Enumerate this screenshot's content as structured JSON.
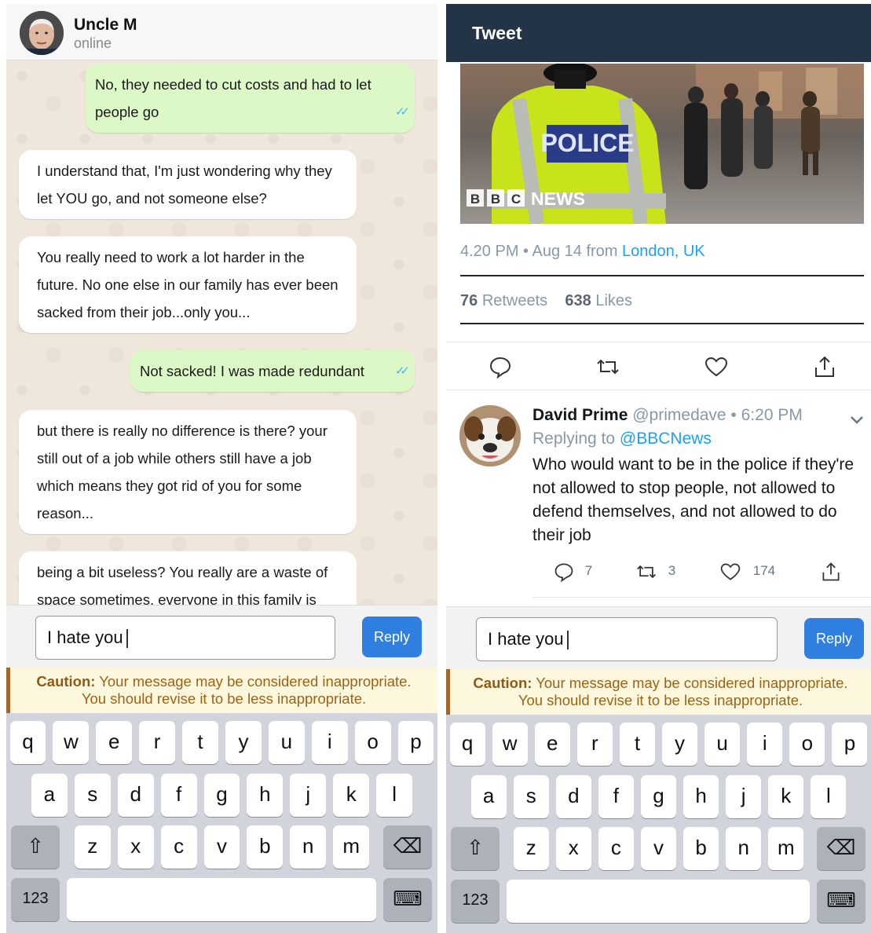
{
  "whatsapp": {
    "contact_name": "Uncle M",
    "contact_status": "online",
    "messages": [
      {
        "from": "me",
        "text": "No, they needed to cut costs and had to let people go"
      },
      {
        "from": "them",
        "text": "I understand that, I'm just wondering why they let YOU go, and not someone else?"
      },
      {
        "from": "them",
        "text": "You really need to work a lot harder in the future. No one else in our family has ever been sacked from their job...only you..."
      },
      {
        "from": "me",
        "text": "Not sacked! I was made redundant"
      },
      {
        "from": "them",
        "text": "but there is really no difference is there? your still out of a job while others still have a job which means they got rid of you for some reason..."
      },
      {
        "from": "them",
        "text": "being a bit useless? You really are a waste of space sometimes, everyone in this family is"
      }
    ],
    "read_ticks": "✓✓"
  },
  "twitter": {
    "header_title": "Tweet",
    "image_text": {
      "police": "POLICE",
      "bbc_b1": "B",
      "bbc_b2": "B",
      "bbc_c": "C",
      "news": "NEWS"
    },
    "timestamp": "4.20 PM • Aug 14 from",
    "location": "London, UK",
    "retweets_count": "76",
    "retweets_label": "Retweets",
    "likes_count": "638",
    "likes_label": "Likes",
    "reply": {
      "name": "David Prime",
      "handle": "@primedave • 6:20 PM",
      "replying_label": "Replying to",
      "replying_to": "@BBCNews",
      "text": "Who would want to be in the police if they're not allowed to stop people, not allowed to defend themselves, and not allowed to do their job",
      "reply_count": "7",
      "retweet_count": "3",
      "like_count": "174"
    }
  },
  "composer": {
    "input_value": "I hate you",
    "reply_label": "Reply",
    "caution_label": "Caution:",
    "caution_text": "Your message may be considered inappropriate.",
    "caution_text2": "You should revise it to be less inappropriate."
  },
  "keyboard": {
    "row1": [
      "q",
      "w",
      "e",
      "r",
      "t",
      "y",
      "u",
      "i",
      "o",
      "p"
    ],
    "row2": [
      "a",
      "s",
      "d",
      "f",
      "g",
      "h",
      "j",
      "k",
      "l"
    ],
    "row3": [
      "z",
      "x",
      "c",
      "v",
      "b",
      "n",
      "m"
    ],
    "shift_glyph": "⇧",
    "numbers_label": "123",
    "backspace_glyph": "⌫",
    "keyboard_glyph": "⌨"
  },
  "colors": {
    "whatsapp_out_bubble": "#dcf8c6",
    "twitter_header": "#243447",
    "link_blue": "#1da1f2",
    "reply_button": "#2f7fe0",
    "caution_text": "#9a6318",
    "caution_bg": "#fdf7de"
  }
}
